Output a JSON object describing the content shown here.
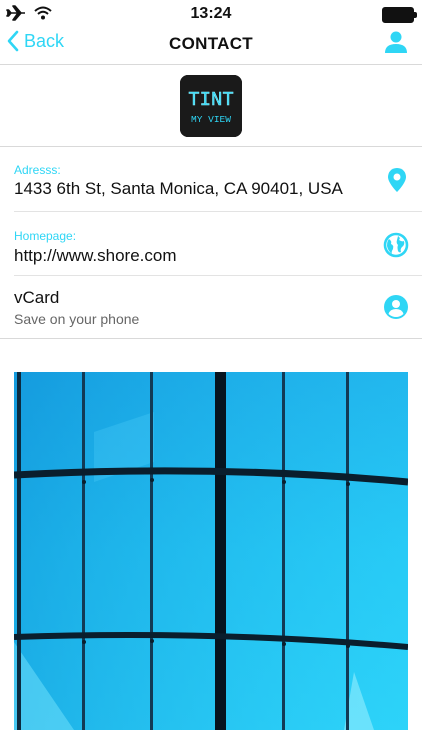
{
  "status_bar": {
    "time": "13:24",
    "icons": [
      "airplane-icon",
      "wifi-icon",
      "battery-icon"
    ]
  },
  "nav": {
    "back_label": "Back",
    "title": "CONTACT",
    "right_icon": "user-icon"
  },
  "logo": {
    "line1": "TINT",
    "line2": "MY VIEW"
  },
  "contact": {
    "address": {
      "label": "Adresss:",
      "value": "1433 6th St, Santa Monica, CA 90401, USA",
      "icon": "location-pin-icon"
    },
    "homepage": {
      "label": "Homepage:",
      "value": "http://www.shore.com",
      "icon": "globe-icon"
    },
    "vcard": {
      "title": "vCard",
      "subtitle": "Save on your phone",
      "icon": "user-circle-icon"
    }
  },
  "colors": {
    "accent": "#2fd6f5",
    "text": "#111111",
    "muted": "#666666"
  }
}
